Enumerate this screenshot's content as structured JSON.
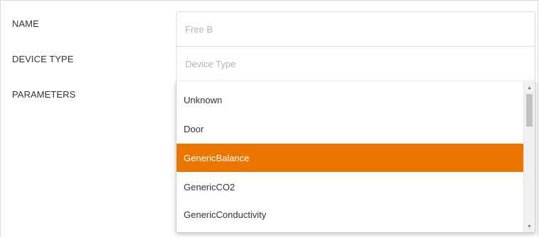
{
  "form": {
    "name_label": "NAME",
    "name_placeholder": "Free B",
    "device_type_label": "DEVICE TYPE",
    "device_type_placeholder": "Device Type",
    "parameters_label": "PARAMETERS"
  },
  "dropdown": {
    "options": [
      {
        "label": "Unknown",
        "selected": false
      },
      {
        "label": "Door",
        "selected": false
      },
      {
        "label": "GenericBalance",
        "selected": true
      },
      {
        "label": "GenericCO2",
        "selected": false
      },
      {
        "label": "GenericConductivity",
        "selected": false
      }
    ],
    "selected_color": "#ea7600",
    "scroll_up_icon": "triangle-up",
    "scroll_down_icon": "triangle-down"
  }
}
